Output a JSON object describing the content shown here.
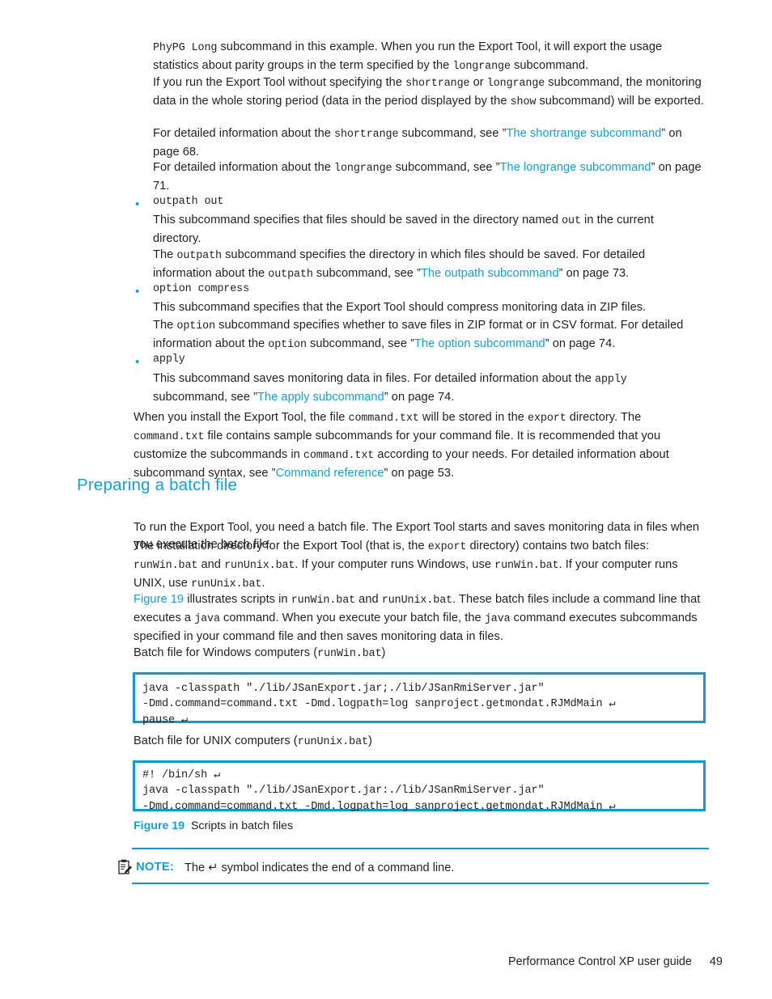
{
  "document": {
    "title": "Performance Control XP user guide",
    "page_number": "49",
    "accent_color": "#12a0db",
    "code_border_color": "#0b9ad9",
    "text_color": "#231f20"
  },
  "paragraphs": {
    "p1": {
      "seg1": "PhyPG Long",
      "seg2": " subcommand in this example. When you run the Export Tool, it will export the usage statistics about parity groups in the term specified by the ",
      "seg3": "longrange",
      "seg4": " subcommand."
    },
    "p2": {
      "seg1": "If you run the Export Tool without specifying the ",
      "seg2": "shortrange",
      "seg3": " or ",
      "seg4": "longrange",
      "seg5": " subcommand, the monitoring data in the whole storing period (data in the period displayed by the ",
      "seg6": "show",
      "seg7": " subcommand) will be exported."
    },
    "p3": {
      "seg1": "For detailed information about the ",
      "seg2": "shortrange",
      "seg3": " subcommand, see ”",
      "link": "The shortrange subcommand",
      "seg4": "” on page 68."
    },
    "p4": {
      "seg1": "For detailed information about the ",
      "seg2": "longrange",
      "seg3": " subcommand, see ”",
      "link": "The longrange subcommand",
      "seg4": "” on page 71."
    },
    "p5": {
      "seg1": "This subcommand specifies that files should be saved in the directory named ",
      "seg2": "out",
      "seg3": " in the current directory."
    },
    "p6": {
      "seg1": "The ",
      "seg2": "outpath",
      "seg3": " subcommand specifies the directory in which files should be saved. For detailed information about the ",
      "seg4": "outpath",
      "seg5": " subcommand, see ”",
      "link": "The outpath subcommand",
      "seg6": "” on page 73."
    },
    "p7": {
      "seg1": "This subcommand specifies that the Export Tool should compress monitoring data in ZIP files."
    },
    "p8": {
      "seg1": "The ",
      "seg2": "option",
      "seg3": " subcommand specifies whether to save files in ZIP format or in CSV format. For detailed information about the ",
      "seg4": "option",
      "seg5": " subcommand, see ”",
      "link": "The option subcommand",
      "seg6": "” on page 74."
    },
    "p9": {
      "seg1": "This subcommand saves monitoring data in files. For detailed information about the ",
      "seg2": "apply",
      "seg3": " subcommand, see ”",
      "link": "The apply subcommand",
      "seg4": "” on page 74."
    },
    "p10": {
      "seg1": "When you install the Export Tool, the file ",
      "seg2": "command.txt",
      "seg3": " will be stored in the ",
      "seg4": "export",
      "seg5": " directory. The ",
      "seg6": "command.txt",
      "seg7": " file contains sample subcommands for your command file. It is recommended that you customize the subcommands in ",
      "seg8": "command.txt",
      "seg9": " according to your needs. For detailed information about subcommand syntax, see ”",
      "link": "Command reference",
      "seg10": "” on page 53."
    },
    "p11": {
      "seg1": "To run the Export Tool, you need a batch file. The Export Tool starts and saves monitoring data in files when you execute the batch file."
    },
    "p12": {
      "seg1": "The installation directory for the Export Tool (that is, the ",
      "seg2": "export",
      "seg3": " directory) contains two batch files: ",
      "seg4": "runWin.bat",
      "seg5": " and ",
      "seg6": "runUnix.bat",
      "seg7": ". If your computer runs Windows, use ",
      "seg8": "runWin.bat",
      "seg9": ". If your computer runs UNIX, use ",
      "seg10": "runUnix.bat",
      "seg11": "."
    },
    "p13": {
      "link": "Figure 19",
      "seg1": " illustrates scripts in ",
      "seg2": "runWin.bat",
      "seg3": " and ",
      "seg4": "runUnix.bat",
      "seg5": ". These batch files include a command line that executes a ",
      "seg6": "java",
      "seg7": " command. When you execute your batch file, the ",
      "seg8": "java",
      "seg9": " command executes subcommands specified in your command file and then saves monitoring data in files."
    }
  },
  "bullets": {
    "b1": "outpath out",
    "b2": "option compress",
    "b3": "apply"
  },
  "headings": {
    "preparing_batch_file": "Preparing a batch file"
  },
  "code_labels": {
    "windows": {
      "text1": "Batch file for Windows computers (",
      "mono": "runWin.bat",
      "text2": ")"
    },
    "unix": {
      "text1": "Batch file for UNIX computers (",
      "mono": "runUnix.bat",
      "text2": ")"
    }
  },
  "code_blocks": {
    "windows": "java -classpath \"./lib/JSanExport.jar;./lib/JSanRmiServer.jar\"\n-Dmd.command=command.txt -Dmd.logpath=log sanproject.getmondat.RJMdMain ↵\npause ↵",
    "unix": "#! /bin/sh ↵\njava -classpath \"./lib/JSanExport.jar:./lib/JSanRmiServer.jar\"\n-Dmd.command=command.txt -Dmd.logpath=log sanproject.getmondat.RJMdMain ↵"
  },
  "figure": {
    "label": "Figure 19",
    "caption": "Scripts in batch files"
  },
  "note": {
    "label": "NOTE:",
    "icon": "note-clipboard-pencil-icon",
    "text": "The ↵ symbol indicates the end of a command line."
  }
}
